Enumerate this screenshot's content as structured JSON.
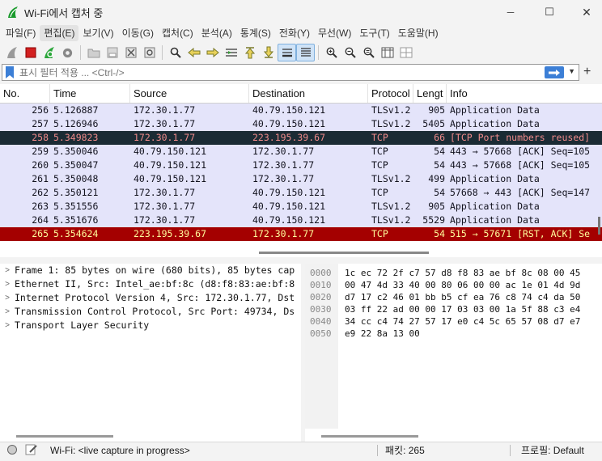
{
  "window": {
    "title": "Wi-Fi에서 캡처 중",
    "minimize_glyph": "─",
    "maximize_glyph": "☐",
    "close_glyph": "✕"
  },
  "menu": [
    "파일(F)",
    "편집(E)",
    "보기(V)",
    "이동(G)",
    "캡처(C)",
    "분석(A)",
    "통계(S)",
    "전화(Y)",
    "무선(W)",
    "도구(T)",
    "도움말(H)"
  ],
  "filter": {
    "placeholder": "표시 필터 적용 ... <Ctrl-/>",
    "add_label": "+"
  },
  "columns": [
    "No.",
    "Time",
    "Source",
    "Destination",
    "Protocol",
    "Lengt",
    "Info"
  ],
  "packets": [
    {
      "no": "256",
      "time": "5.126887",
      "src": "172.30.1.77",
      "dst": "40.79.150.121",
      "proto": "TLSv1.2",
      "len": "905",
      "info": "Application Data",
      "style": "tls"
    },
    {
      "no": "257",
      "time": "5.126946",
      "src": "172.30.1.77",
      "dst": "40.79.150.121",
      "proto": "TLSv1.2",
      "len": "5405",
      "info": "Application Data",
      "style": "tls"
    },
    {
      "no": "258",
      "time": "5.349823",
      "src": "172.30.1.77",
      "dst": "223.195.39.67",
      "proto": "TCP",
      "len": "66",
      "info": "[TCP Port numbers reused]",
      "style": "sel"
    },
    {
      "no": "259",
      "time": "5.350046",
      "src": "40.79.150.121",
      "dst": "172.30.1.77",
      "proto": "TCP",
      "len": "54",
      "info": "443 → 57668 [ACK] Seq=105",
      "style": "tls"
    },
    {
      "no": "260",
      "time": "5.350047",
      "src": "40.79.150.121",
      "dst": "172.30.1.77",
      "proto": "TCP",
      "len": "54",
      "info": "443 → 57668 [ACK] Seq=105",
      "style": "tls"
    },
    {
      "no": "261",
      "time": "5.350048",
      "src": "40.79.150.121",
      "dst": "172.30.1.77",
      "proto": "TLSv1.2",
      "len": "499",
      "info": "Application Data",
      "style": "tls"
    },
    {
      "no": "262",
      "time": "5.350121",
      "src": "172.30.1.77",
      "dst": "40.79.150.121",
      "proto": "TCP",
      "len": "54",
      "info": "57668 → 443 [ACK] Seq=147",
      "style": "tls"
    },
    {
      "no": "263",
      "time": "5.351556",
      "src": "172.30.1.77",
      "dst": "40.79.150.121",
      "proto": "TLSv1.2",
      "len": "905",
      "info": "Application Data",
      "style": "tls"
    },
    {
      "no": "264",
      "time": "5.351676",
      "src": "172.30.1.77",
      "dst": "40.79.150.121",
      "proto": "TLSv1.2",
      "len": "5529",
      "info": "Application Data",
      "style": "tls"
    },
    {
      "no": "265",
      "time": "5.354624",
      "src": "223.195.39.67",
      "dst": "172.30.1.77",
      "proto": "TCP",
      "len": "54",
      "info": "515 → 57671 [RST, ACK] Se",
      "style": "rst"
    }
  ],
  "details": [
    "Frame 1: 85 bytes on wire (680 bits), 85 bytes cap",
    "Ethernet II, Src: Intel_ae:bf:8c (d8:f8:83:ae:bf:8",
    "Internet Protocol Version 4, Src: 172.30.1.77, Dst",
    "Transmission Control Protocol, Src Port: 49734, Ds",
    "Transport Layer Security"
  ],
  "bytes": [
    {
      "offset": "0000",
      "hex": "1c ec 72 2f c7 57 d8 f8  83 ae bf 8c 08 00 45"
    },
    {
      "offset": "0010",
      "hex": "00 47 4d 33 40 00 80 06  00 00 ac 1e 01 4d 9d"
    },
    {
      "offset": "0020",
      "hex": "d7 17 c2 46 01 bb b5 cf  ea 76 c8 74 c4 da 50"
    },
    {
      "offset": "0030",
      "hex": "03 ff 22 ad 00 00 17 03  03 00 1a 5f 88 c3 e4"
    },
    {
      "offset": "0040",
      "hex": "34 cc c4 74 27 57 17 e0  c4 5c 65 57 08 d7 e7"
    },
    {
      "offset": "0050",
      "hex": "e9 22 8a 13 00"
    }
  ],
  "status": {
    "capture": "Wi-Fi: <live capture in progress>",
    "packets": "패킷: 265",
    "profile": "프로필: Default"
  },
  "colors": {
    "accent": "#3c7fd6",
    "tls_row": "#e4e4fa",
    "selected_row": "#1b2b34",
    "rst_row": "#a40000"
  }
}
